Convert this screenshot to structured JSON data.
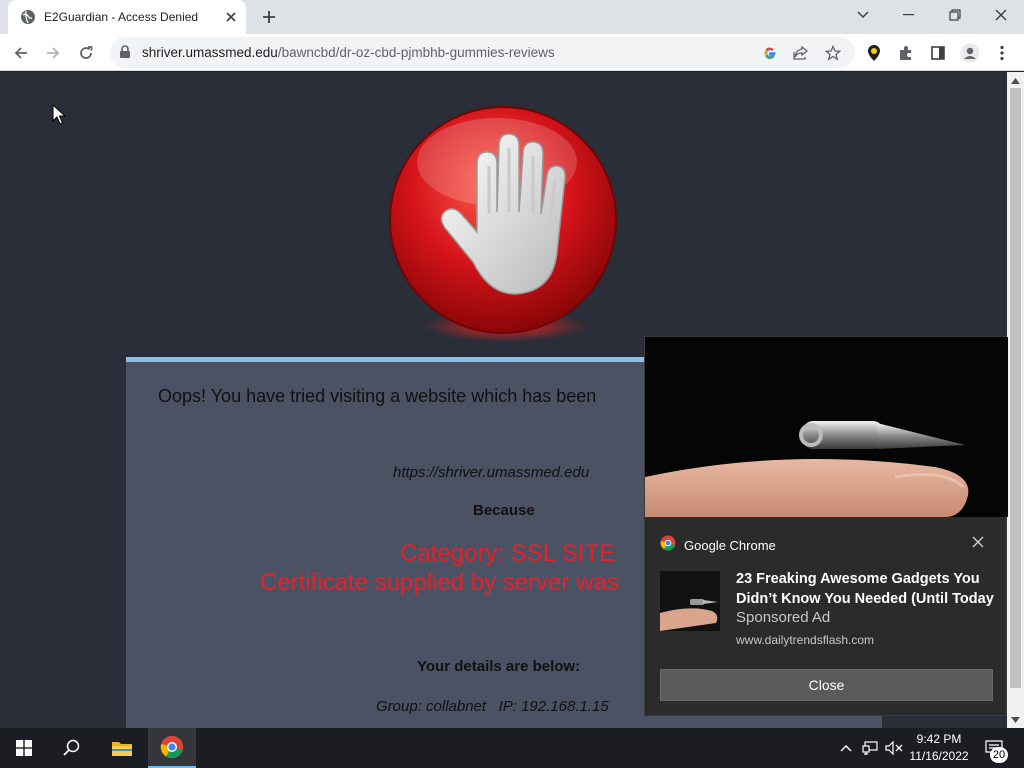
{
  "browser": {
    "tab_title": "E2Guardian - Access Denied",
    "url_host": "shriver.umassmed.edu",
    "url_path": "/bawncbd/dr-oz-cbd-pjmbhb-gummies-reviews",
    "icons": [
      "globe-icon",
      "close-icon",
      "new-tab-icon",
      "tab-search-icon",
      "minimize-icon",
      "restore-icon",
      "window-close-icon",
      "back-icon",
      "forward-icon",
      "reload-icon",
      "lock-icon",
      "google-icon",
      "share-icon",
      "bookmark-star-icon",
      "extension-location-icon",
      "extensions-puzzle-icon",
      "side-panel-icon",
      "profile-icon",
      "kebab-menu-icon"
    ]
  },
  "blockpage": {
    "headline": "Oops! You have tried visiting a website which has been",
    "blocked_url": "https://shriver.umassmed.edu",
    "because": "Because",
    "category": "Category: SSL SITE",
    "certificate": "Certificate supplied by server was",
    "details_heading": "Your details are below:",
    "group_line": "Group: collabnet   IP: 192.168.1.15"
  },
  "notification": {
    "app_name": "Google Chrome",
    "title": "23 Freaking Awesome Gadgets You Didn’t Know You Needed (Until Today",
    "subtitle": "Sponsored Ad",
    "domain": "www.dailytrendsflash.com",
    "close_label": "Close"
  },
  "taskbar": {
    "time": "9:42 PM",
    "date": "11/16/2022",
    "notification_count": "20",
    "icons": [
      "windows-start-icon",
      "search-icon",
      "file-explorer-icon",
      "chrome-icon",
      "chevron-up-icon",
      "network-icon",
      "mute-speaker-icon",
      "action-center-icon"
    ]
  },
  "colors": {
    "page_bg": "#2a2e38",
    "panel_bg": "#4b5264",
    "panel_border": "#8ec1ea",
    "alert_red": "#e8202a",
    "taskbar_bg": "#1c1d22"
  }
}
